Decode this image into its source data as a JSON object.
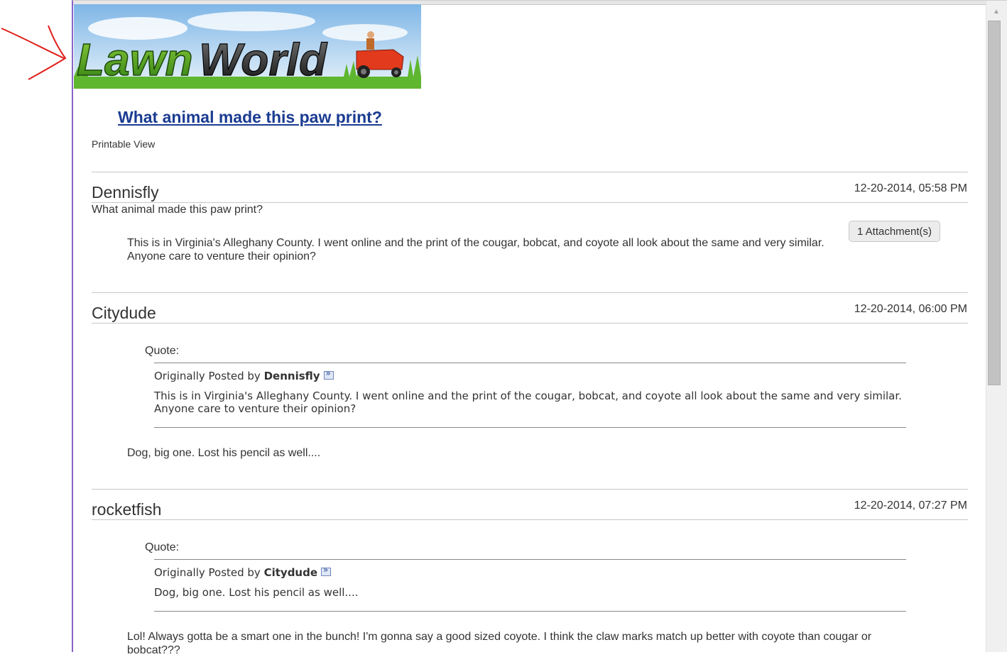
{
  "logo": {
    "text_lawn": "Lawn",
    "text_world": "World"
  },
  "thread": {
    "title": "What animal made this paw print?",
    "printable_label": "Printable View"
  },
  "posts": [
    {
      "author": "Dennisfly",
      "date": "12-20-2014, 05:58 PM",
      "title": "What animal made this paw print?",
      "body_line1": "This is in Virginia's Alleghany County. I went online and the print of the cougar, bobcat, and coyote all look about the same and very similar.",
      "body_line2": "Anyone care to venture their opinion?",
      "attachment_label": "1 Attachment(s)"
    },
    {
      "author": "Citydude",
      "date": "12-20-2014, 06:00 PM",
      "quote_label": "Quote:",
      "quote_prefix": "Originally Posted by",
      "quote_author": "Dennisfly",
      "quote_line1": "This is in Virginia's Alleghany County. I went online and the print of the cougar, bobcat, and coyote all look about the same and very similar.",
      "quote_line2": "Anyone care to venture their opinion?",
      "body": "Dog, big one. Lost his pencil as well...."
    },
    {
      "author": "rocketfish",
      "date": "12-20-2014, 07:27 PM",
      "quote_label": "Quote:",
      "quote_prefix": "Originally Posted by",
      "quote_author": "Citydude",
      "quote_line1": "Dog, big one. Lost his pencil as well....",
      "body_line1": "Lol! Always gotta be a smart one in the bunch! I'm gonna say a good sized coyote. I think the claw marks match up better with coyote than cougar or",
      "body_line2": "bobcat???"
    }
  ],
  "colors": {
    "title_link": "#1a3b91",
    "frame_border": "#8a63c8",
    "annotation": "#e0201c"
  },
  "icons": [
    "view-post-icon",
    "scroll-up-arrow-icon",
    "red-arrow-annotation-icon",
    "red-question-mark-annotation-icon"
  ]
}
